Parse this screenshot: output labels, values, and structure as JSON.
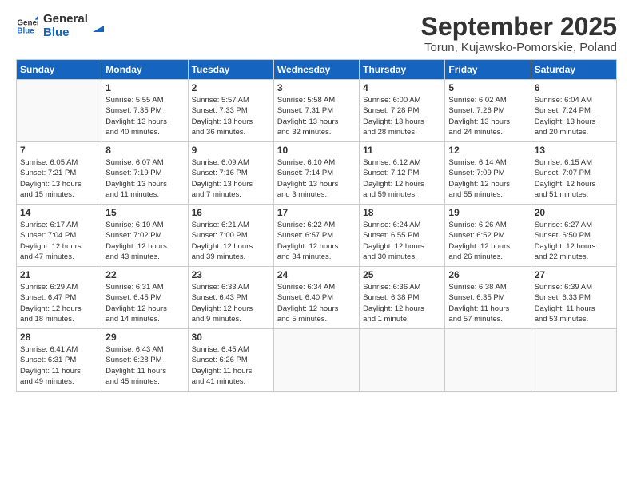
{
  "logo": {
    "line1": "General",
    "line2": "Blue"
  },
  "title": "September 2025",
  "subtitle": "Torun, Kujawsko-Pomorskie, Poland",
  "weekdays": [
    "Sunday",
    "Monday",
    "Tuesday",
    "Wednesday",
    "Thursday",
    "Friday",
    "Saturday"
  ],
  "weeks": [
    [
      {
        "day": "",
        "info": ""
      },
      {
        "day": "1",
        "info": "Sunrise: 5:55 AM\nSunset: 7:35 PM\nDaylight: 13 hours\nand 40 minutes."
      },
      {
        "day": "2",
        "info": "Sunrise: 5:57 AM\nSunset: 7:33 PM\nDaylight: 13 hours\nand 36 minutes."
      },
      {
        "day": "3",
        "info": "Sunrise: 5:58 AM\nSunset: 7:31 PM\nDaylight: 13 hours\nand 32 minutes."
      },
      {
        "day": "4",
        "info": "Sunrise: 6:00 AM\nSunset: 7:28 PM\nDaylight: 13 hours\nand 28 minutes."
      },
      {
        "day": "5",
        "info": "Sunrise: 6:02 AM\nSunset: 7:26 PM\nDaylight: 13 hours\nand 24 minutes."
      },
      {
        "day": "6",
        "info": "Sunrise: 6:04 AM\nSunset: 7:24 PM\nDaylight: 13 hours\nand 20 minutes."
      }
    ],
    [
      {
        "day": "7",
        "info": "Sunrise: 6:05 AM\nSunset: 7:21 PM\nDaylight: 13 hours\nand 15 minutes."
      },
      {
        "day": "8",
        "info": "Sunrise: 6:07 AM\nSunset: 7:19 PM\nDaylight: 13 hours\nand 11 minutes."
      },
      {
        "day": "9",
        "info": "Sunrise: 6:09 AM\nSunset: 7:16 PM\nDaylight: 13 hours\nand 7 minutes."
      },
      {
        "day": "10",
        "info": "Sunrise: 6:10 AM\nSunset: 7:14 PM\nDaylight: 13 hours\nand 3 minutes."
      },
      {
        "day": "11",
        "info": "Sunrise: 6:12 AM\nSunset: 7:12 PM\nDaylight: 12 hours\nand 59 minutes."
      },
      {
        "day": "12",
        "info": "Sunrise: 6:14 AM\nSunset: 7:09 PM\nDaylight: 12 hours\nand 55 minutes."
      },
      {
        "day": "13",
        "info": "Sunrise: 6:15 AM\nSunset: 7:07 PM\nDaylight: 12 hours\nand 51 minutes."
      }
    ],
    [
      {
        "day": "14",
        "info": "Sunrise: 6:17 AM\nSunset: 7:04 PM\nDaylight: 12 hours\nand 47 minutes."
      },
      {
        "day": "15",
        "info": "Sunrise: 6:19 AM\nSunset: 7:02 PM\nDaylight: 12 hours\nand 43 minutes."
      },
      {
        "day": "16",
        "info": "Sunrise: 6:21 AM\nSunset: 7:00 PM\nDaylight: 12 hours\nand 39 minutes."
      },
      {
        "day": "17",
        "info": "Sunrise: 6:22 AM\nSunset: 6:57 PM\nDaylight: 12 hours\nand 34 minutes."
      },
      {
        "day": "18",
        "info": "Sunrise: 6:24 AM\nSunset: 6:55 PM\nDaylight: 12 hours\nand 30 minutes."
      },
      {
        "day": "19",
        "info": "Sunrise: 6:26 AM\nSunset: 6:52 PM\nDaylight: 12 hours\nand 26 minutes."
      },
      {
        "day": "20",
        "info": "Sunrise: 6:27 AM\nSunset: 6:50 PM\nDaylight: 12 hours\nand 22 minutes."
      }
    ],
    [
      {
        "day": "21",
        "info": "Sunrise: 6:29 AM\nSunset: 6:47 PM\nDaylight: 12 hours\nand 18 minutes."
      },
      {
        "day": "22",
        "info": "Sunrise: 6:31 AM\nSunset: 6:45 PM\nDaylight: 12 hours\nand 14 minutes."
      },
      {
        "day": "23",
        "info": "Sunrise: 6:33 AM\nSunset: 6:43 PM\nDaylight: 12 hours\nand 9 minutes."
      },
      {
        "day": "24",
        "info": "Sunrise: 6:34 AM\nSunset: 6:40 PM\nDaylight: 12 hours\nand 5 minutes."
      },
      {
        "day": "25",
        "info": "Sunrise: 6:36 AM\nSunset: 6:38 PM\nDaylight: 12 hours\nand 1 minute."
      },
      {
        "day": "26",
        "info": "Sunrise: 6:38 AM\nSunset: 6:35 PM\nDaylight: 11 hours\nand 57 minutes."
      },
      {
        "day": "27",
        "info": "Sunrise: 6:39 AM\nSunset: 6:33 PM\nDaylight: 11 hours\nand 53 minutes."
      }
    ],
    [
      {
        "day": "28",
        "info": "Sunrise: 6:41 AM\nSunset: 6:31 PM\nDaylight: 11 hours\nand 49 minutes."
      },
      {
        "day": "29",
        "info": "Sunrise: 6:43 AM\nSunset: 6:28 PM\nDaylight: 11 hours\nand 45 minutes."
      },
      {
        "day": "30",
        "info": "Sunrise: 6:45 AM\nSunset: 6:26 PM\nDaylight: 11 hours\nand 41 minutes."
      },
      {
        "day": "",
        "info": ""
      },
      {
        "day": "",
        "info": ""
      },
      {
        "day": "",
        "info": ""
      },
      {
        "day": "",
        "info": ""
      }
    ]
  ]
}
